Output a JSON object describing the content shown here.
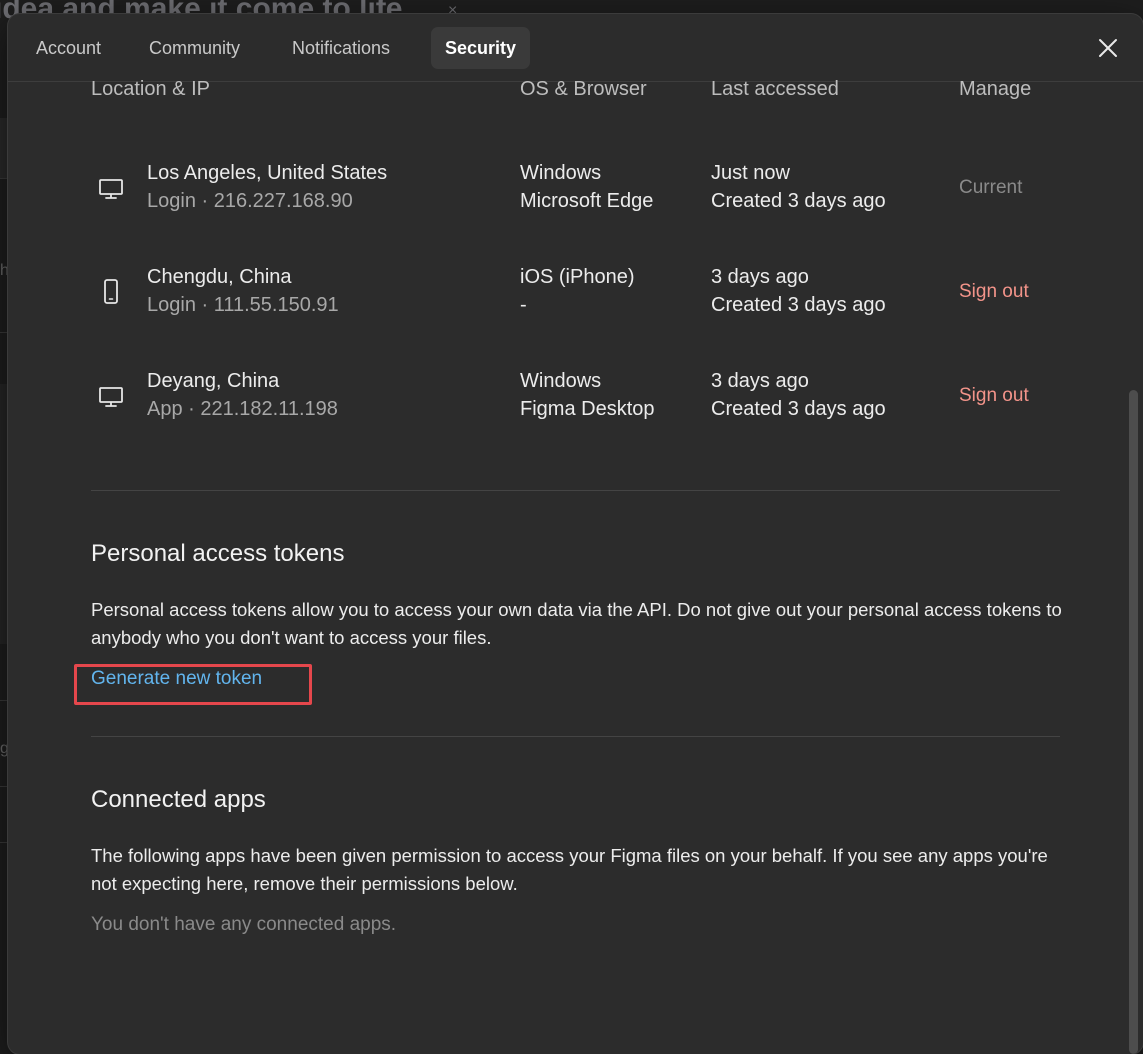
{
  "background": {
    "title_fragment": "idea and make it come to life",
    "tab_close_glyph": "×",
    "side_glyph_1": "h",
    "side_glyph_2": "g"
  },
  "tabs": [
    {
      "label": "Account",
      "active": false
    },
    {
      "label": "Community",
      "active": false
    },
    {
      "label": "Notifications",
      "active": false
    },
    {
      "label": "Security",
      "active": true
    }
  ],
  "close_icon": "close-icon",
  "sessions": {
    "headers": {
      "location": "Location & IP",
      "os": "OS & Browser",
      "last_accessed": "Last accessed",
      "manage": "Manage"
    },
    "rows": [
      {
        "device_icon": "desktop-icon",
        "location": "Los Angeles, United States",
        "detail": "Login · 216.227.168.90",
        "os": "Windows",
        "browser": "Microsoft Edge",
        "last_accessed": "Just now",
        "created": "Created 3 days ago",
        "manage": "Current"
      },
      {
        "device_icon": "phone-icon",
        "location": "Chengdu, China",
        "detail": "Login · 111.55.150.91",
        "os": "iOS (iPhone)",
        "browser": "-",
        "last_accessed": "3 days ago",
        "created": "Created 3 days ago",
        "manage": "Sign out"
      },
      {
        "device_icon": "desktop-icon",
        "location": "Deyang, China",
        "detail": "App · 221.182.11.198",
        "os": "Windows",
        "browser": "Figma Desktop",
        "last_accessed": "3 days ago",
        "created": "Created 3 days ago",
        "manage": "Sign out"
      }
    ]
  },
  "tokens": {
    "title": "Personal access tokens",
    "description": "Personal access tokens allow you to access your own data via the API. Do not give out your personal access tokens to anybody who you don't want to access your files.",
    "generate_label": "Generate new token"
  },
  "connected_apps": {
    "title": "Connected apps",
    "description": "The following apps have been given permission to access your Figma files on your behalf. If you see any apps you're not expecting here, remove their permissions below.",
    "empty_text": "You don't have any connected apps."
  },
  "colors": {
    "modal_bg": "#2c2c2c",
    "link": "#62b5ee",
    "sign_out": "#f3948a",
    "highlight": "#e5474c"
  }
}
